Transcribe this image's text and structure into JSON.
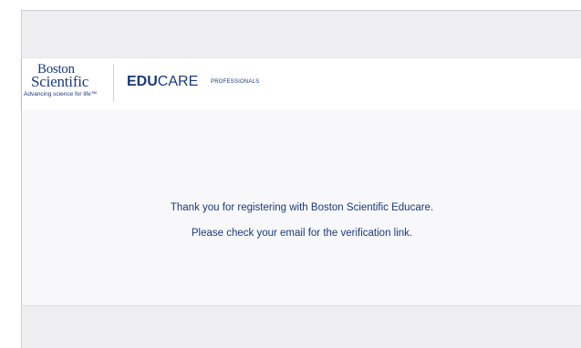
{
  "logo": {
    "line1": "Boston",
    "line2": "Scientific",
    "tagline": "Advancing science for life™"
  },
  "brand": {
    "edu": "EDU",
    "care": "CARE",
    "professionals": "PROFESSIONALS"
  },
  "message": {
    "line1": "Thank you for registering with Boston Scientific Educare.",
    "line2": "Please check your email for the verification link."
  },
  "colors": {
    "brand_blue": "#1a3a7a",
    "page_background": "#efeff1",
    "panel_background": "#f8f8fa"
  }
}
